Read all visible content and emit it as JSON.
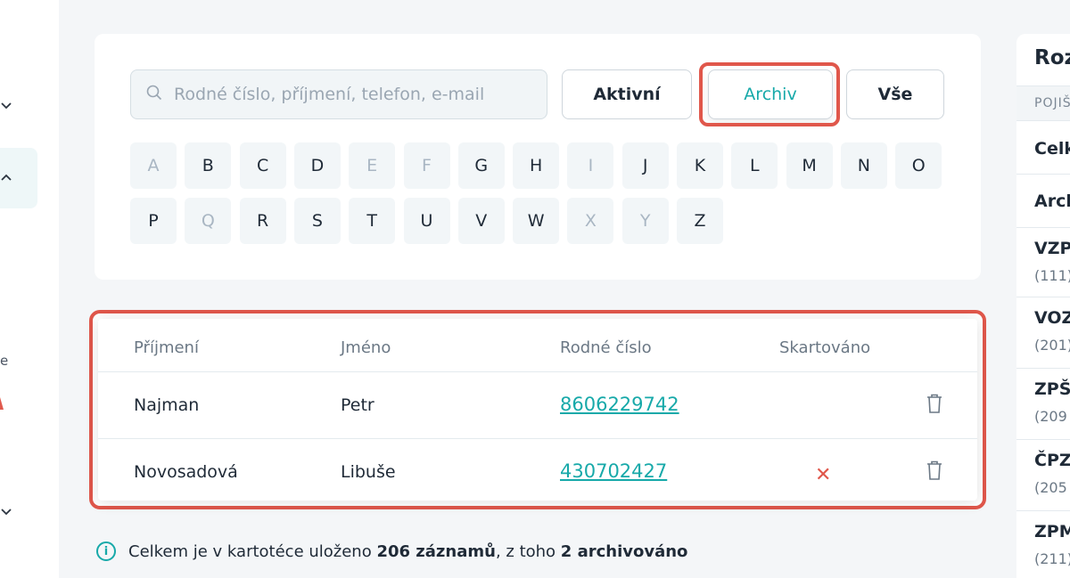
{
  "search": {
    "placeholder": "Rodné číslo, příjmení, telefon, e-mail",
    "value": ""
  },
  "filters": {
    "aktivni": "Aktivní",
    "archiv": "Archiv",
    "vse": "Vše",
    "selected": "Archiv"
  },
  "letters": [
    {
      "l": "A",
      "enabled": false
    },
    {
      "l": "B",
      "enabled": true
    },
    {
      "l": "C",
      "enabled": true
    },
    {
      "l": "D",
      "enabled": true
    },
    {
      "l": "E",
      "enabled": false
    },
    {
      "l": "F",
      "enabled": false
    },
    {
      "l": "G",
      "enabled": true
    },
    {
      "l": "H",
      "enabled": true
    },
    {
      "l": "I",
      "enabled": false
    },
    {
      "l": "J",
      "enabled": true
    },
    {
      "l": "K",
      "enabled": true
    },
    {
      "l": "L",
      "enabled": true
    },
    {
      "l": "M",
      "enabled": true
    },
    {
      "l": "N",
      "enabled": true
    },
    {
      "l": "O",
      "enabled": true
    },
    {
      "l": "P",
      "enabled": true
    },
    {
      "l": "Q",
      "enabled": false
    },
    {
      "l": "R",
      "enabled": true
    },
    {
      "l": "S",
      "enabled": true
    },
    {
      "l": "T",
      "enabled": true
    },
    {
      "l": "U",
      "enabled": true
    },
    {
      "l": "V",
      "enabled": true
    },
    {
      "l": "W",
      "enabled": true
    },
    {
      "l": "X",
      "enabled": false
    },
    {
      "l": "Y",
      "enabled": false
    },
    {
      "l": "Z",
      "enabled": true
    }
  ],
  "table": {
    "headers": {
      "prijmeni": "Příjmení",
      "jmeno": "Jméno",
      "rodne_cislo": "Rodné číslo",
      "skartovano": "Skartováno"
    },
    "rows": [
      {
        "prijmeni": "Najman",
        "jmeno": "Petr",
        "rodne_cislo": "8606229742",
        "skartovano": false
      },
      {
        "prijmeni": "Novosadová",
        "jmeno": "Libuše",
        "rodne_cislo": "430702427",
        "skartovano": true
      }
    ]
  },
  "footer": {
    "prefix": "Celkem je v kartotéce uloženo",
    "total": "206 záznamů",
    "middle": ", z toho",
    "archived": "2 archivováno"
  },
  "right_panel": {
    "title": "Roz",
    "header": "POJIŠ",
    "items": [
      {
        "name": "Celk",
        "count": ""
      },
      {
        "name": "Arch",
        "count": ""
      },
      {
        "name": "VZP",
        "count": "(111)"
      },
      {
        "name": "VOZ",
        "count": "(201)"
      },
      {
        "name": "ZPŠ",
        "count": "(209"
      },
      {
        "name": "ČPZ",
        "count": "(205"
      },
      {
        "name": "ZPM",
        "count": "(211)"
      }
    ]
  },
  "sidebar": {
    "partial_text": "e"
  },
  "colors": {
    "accent": "#17a9a9",
    "highlight": "#e0574b"
  }
}
